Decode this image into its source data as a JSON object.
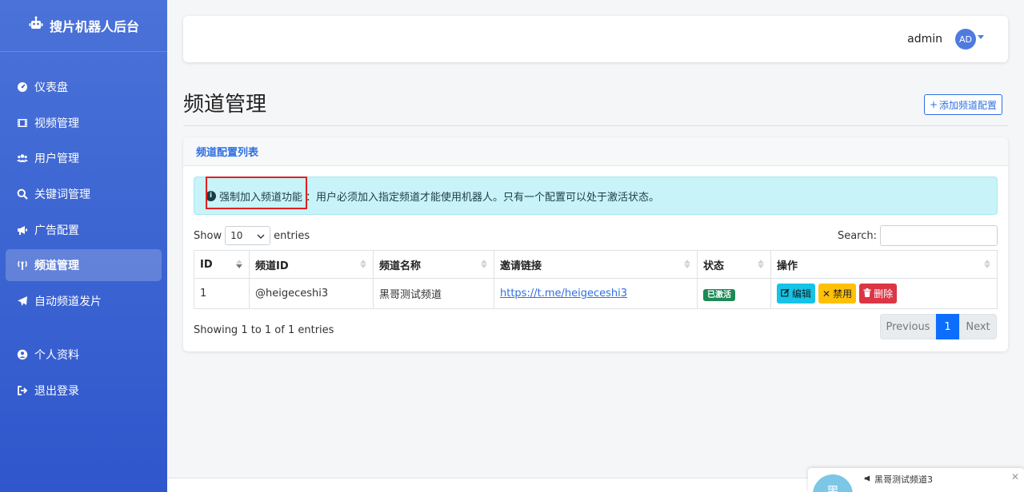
{
  "app": {
    "brand": "搜片机器人后台"
  },
  "sidebar": {
    "items": [
      {
        "label": "仪表盘",
        "icon": "gauge-icon"
      },
      {
        "label": "视频管理",
        "icon": "film-icon"
      },
      {
        "label": "用户管理",
        "icon": "users-icon"
      },
      {
        "label": "关键词管理",
        "icon": "search-icon"
      },
      {
        "label": "广告配置",
        "icon": "megaphone-icon"
      },
      {
        "label": "频道管理",
        "icon": "broadcast-icon"
      },
      {
        "label": "自动频道发片",
        "icon": "paper-plane-icon"
      }
    ],
    "items2": [
      {
        "label": "个人资料",
        "icon": "user-circle-icon"
      },
      {
        "label": "退出登录",
        "icon": "logout-icon"
      }
    ]
  },
  "topbar": {
    "username": "admin",
    "avatar": "AD"
  },
  "page": {
    "title": "频道管理",
    "add_button": "添加频道配置"
  },
  "card": {
    "header": "频道配置列表",
    "alert_strong": "强制加入频道功能",
    "alert_text": "：用户必须加入指定频道才能使用机器人。只有一个配置可以处于激活状态。",
    "show_label": "Show",
    "page_size": "10",
    "entries_label": "entries",
    "search_label": "Search:"
  },
  "table": {
    "columns": [
      "ID",
      "频道ID",
      "频道名称",
      "邀请链接",
      "状态",
      "操作"
    ],
    "rows": [
      {
        "id": "1",
        "channel_id": "@heigeceshi3",
        "name": "黑哥测试频道",
        "link": "https://t.me/heigeceshi3",
        "status": "已激活"
      }
    ],
    "actions": {
      "edit": "编辑",
      "disable": "禁用",
      "delete": "删除"
    }
  },
  "footer": {
    "info": "Showing 1 to 1 of 1 entries",
    "prev": "Previous",
    "page": "1",
    "next": "Next"
  },
  "toast": {
    "avatar": "黑",
    "title": "黑哥测试频道3"
  },
  "colors": {
    "sidebar": "#3a62d3",
    "primary": "#2f6fe0",
    "success": "#1b8a55",
    "info": "#16c3e6",
    "warning": "#ffc107",
    "danger": "#dc3545"
  }
}
